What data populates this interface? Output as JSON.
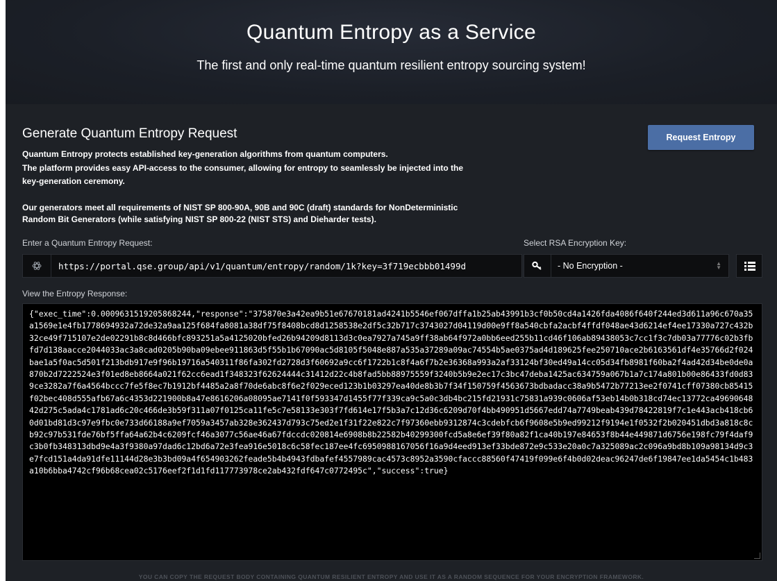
{
  "header": {
    "title": "Quantum Entropy as a Service",
    "subtitle": "The first and only real-time quantum resilient entropy sourcing system!"
  },
  "section": {
    "title": "Generate Quantum Entropy Request",
    "request_button": "Request Entropy",
    "description_lines": [
      "Quantum Entropy protects established key-generation algorithms from quantum computers.",
      "The platform provides easy API-access to the consumer, allowing for entropy to seamlessly be injected into the",
      "key-generation ceremony.",
      "Our generators meet all requirements of NIST SP 800-90A, 90B and 90C (draft) standards for NonDeterministic",
      "Random Bit Generators (while satisfying NIST SP 800-22 (NIST STS) and Dieharder tests)."
    ]
  },
  "request": {
    "label": "Enter a Quantum Entropy Request:",
    "value": "https://portal.qse.group/api/v1/quantum/entropy/random/1k?key=3f719ecbbb01499d",
    "icon": "atom-icon"
  },
  "encryption": {
    "label": "Select RSA Encryption Key:",
    "selected": "- No Encryption -",
    "icon": "key-icon",
    "list_icon": "list-icon"
  },
  "response": {
    "label": "View the Entropy Response:",
    "body": "{\"exec_time\":0.0009631519205868244,\"response\":\"375870e3a42ea9b51e67670181ad4241b5546ef067dffa1b25ab43991b3cf0b50cd4a1426fda4086f640f244ed3d611a96c670a35a1569e1e4fb1778694932a72de32a9aa125f684fa8081a38df75f8408bcd8d1258538e2df5c32b717c3743027d04119d00e9ff8a540cbfa2acbf4ffdf048ae43d6214ef4ee17330a727c432b32ce49f715107e2de02291b8c8d466bfc893251a5a4125020bfed26b94209d8113d3c0ea7927a745a9ff38ab64f972a0bb6eed255b11cd46f106ab89438053c7cc1f3c7db03a77776c02b3fbfd7d138aacce2044033ac3a8cad0205b90ba09ebee911863d5f55b1b67090ac5d8105f5048e887a535a37289a09ac74554b5ae0375ad4d189625fee250710ace2b6163561df4e35766d2f024bae1a5f0ac5d501f213bdb917e9f96b19716a540311f86fa302fd2728d3f60692a9cc6f1722b1c8f4a6f7b2e36368a993a2af33124bf30ed49a14cc05d34fb8981f60ba2f4ad42d34be0de0a870b2d7222524e3f01ed8eb8664a021f62cc6ead1f348323f62624444c31412d22c4b8fad5bb88975559f3240b5b9e2ec17c3bc47deba1425ac634759a067b1a7c174a801b00e86433fd0d839ce3282a7f6a4564bccc7fe5f8ec7b1912bf4485a2a8f70de6abc8f6e2f029eced123b1b03297ea40de8b3b7f34f150759f4563673bdbadacc38a9b5472b77213ee2f0741cff07380cb85415f02bec408d555afb67a6c4353d221900b8a47e8616206a08095ae7141f0f593347d1455f77f339ca9c5a0c3db4bc215fd21931c75831a939c0606af53eb14b0b318cd74ec13772ca4969064842d275c5ada4c1781ad6c20c466de3b59f311a07f0125ca11fe5c7e58133e303f7fd614e17f5b3a7c12d36c6209d70f4bb490951d5667edd74a7749beab439d78422819f7c1e443acb418cb60d01bd81d3c97e9fbc0e733d66188a9ef7059a3457ab328e362437d793c75ed2e1f31f22e822c7f97360ebb9312874c3cdebfcb6f9608e5b9ed99212f9194e1f0532f2b020451dbd3a818c8cb92c97b531fde76bf5ffa64a62b4c6209fcf46a3077c56ae46a67fdccdc020814e6908b8b22582b40299300fcd5a8e6ef39f80a82f1ca40b197e84653f8b44e449871d6756e198fc79f4daf9c3b0fb348313dbd9e4a3f9380a97dad6c12bd6a72e3fea916e5018c6c58fec187ee4fc6950988167056f16a9d4eed913ef33bde872e9c533e20a0c7a325089ac2c096a9bd8b109a98134d9c3e7fcd151a4da91dfe11144d28e3b3bd09a4f654903262feade5b4b4943fdbafef4557989cac4573c8952a3590cfaccc88560f47419f099e6f4b0d02deac96247de6f19847ee1da5454c1b483a10b6bba4742cf96b68cea02c5176eef2f1d1fd117773978ce2ab432fdf647c0772495c\",\"success\":true}"
  },
  "footer": {
    "text": "YOU CAN COPY THE REQUEST BODY CONTAINING QUANTUM RESILIENT ENTROPY AND USE IT AS A RANDOM SEQUENCE FOR YOUR ENCRYPTION FRAMEWORK."
  },
  "colors": {
    "background": "#1e2126",
    "accent_button": "#4b6ea5",
    "input_background": "#0d0e10"
  }
}
